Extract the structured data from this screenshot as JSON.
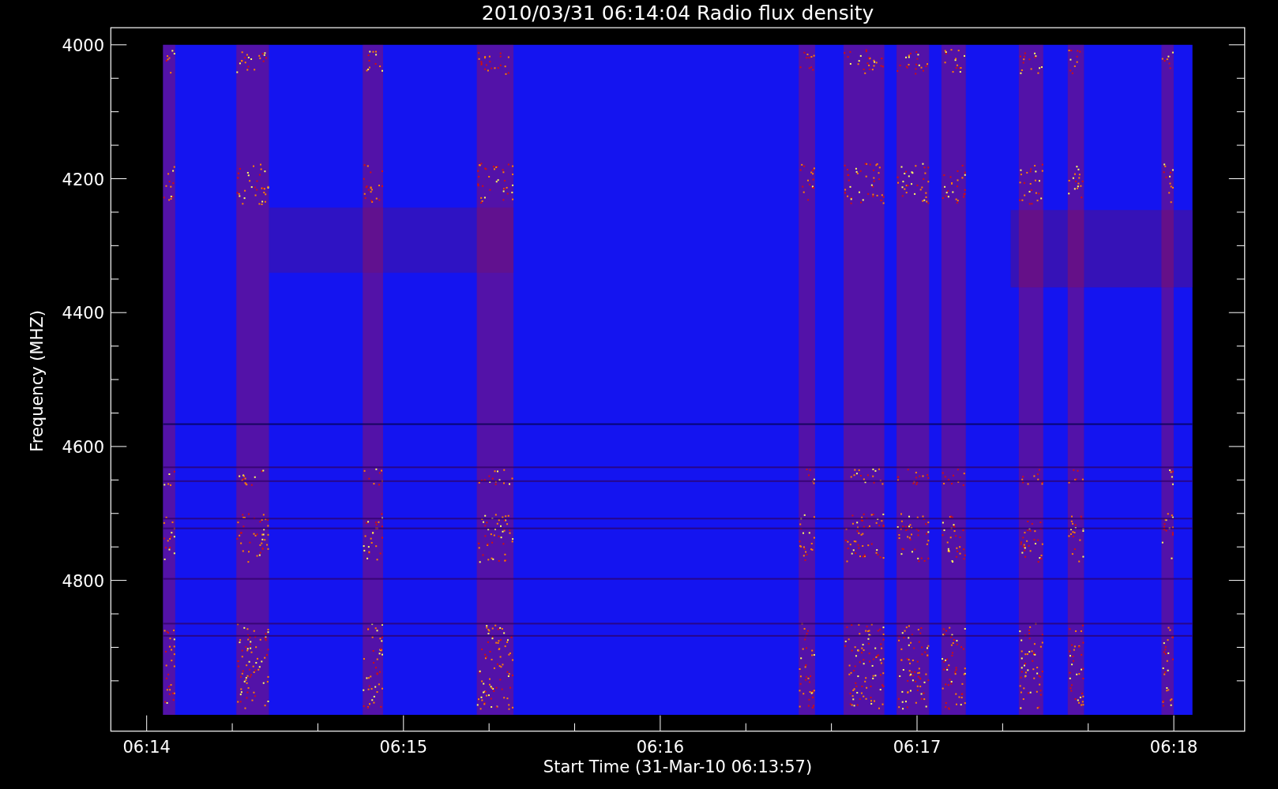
{
  "title": "2010/03/31 06:14:04 Radio flux density",
  "y_axis": {
    "label": "Frequency (MHZ)",
    "ticks": [
      "4000",
      "4200",
      "4400",
      "4600",
      "4800"
    ]
  },
  "x_axis": {
    "label": "Start Time (31-Mar-10 06:13:57)",
    "ticks": [
      "06:14",
      "06:15",
      "06:16",
      "06:17",
      "06:18"
    ]
  }
}
